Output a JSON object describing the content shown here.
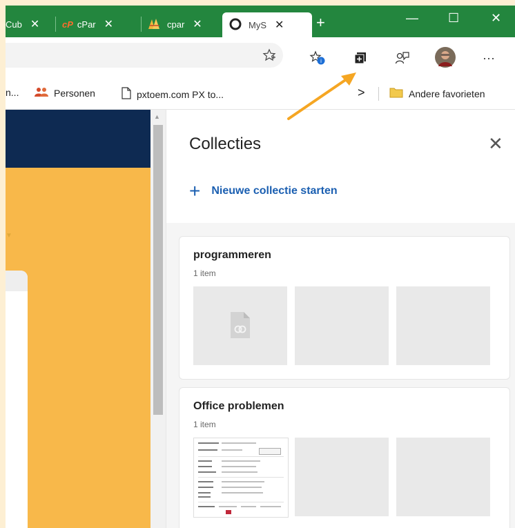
{
  "tabs": [
    {
      "label": "Cub",
      "close": "✕"
    },
    {
      "label": "cPar",
      "close": "✕"
    },
    {
      "label": "cpar",
      "close": "✕"
    },
    {
      "label": "MyS",
      "close": "✕",
      "active": true
    }
  ],
  "tabstrip": {
    "new_tab": "+",
    "minimize": "—",
    "maximize": "☐",
    "close": "✕"
  },
  "toolbar": {
    "more": "···"
  },
  "favorites": [
    {
      "label": "n..."
    },
    {
      "label": "Personen"
    },
    {
      "label": "pxtoem.com PX to..."
    },
    {
      "label": "Andere favorieten"
    }
  ],
  "favorites_overflow": ">",
  "collections": {
    "title": "Collecties",
    "close": "✕",
    "new_plus": "+",
    "new_label": "Nieuwe collectie starten",
    "items": [
      {
        "name": "programmeren",
        "count": "1 item"
      },
      {
        "name": "Office problemen",
        "count": "1 item"
      }
    ]
  },
  "colors": {
    "tab_strip": "#23863e",
    "accent_link": "#1b5fb1",
    "page_yellow": "#f8b84a",
    "page_navy": "#0e2a52",
    "arrow": "#f5a623"
  }
}
